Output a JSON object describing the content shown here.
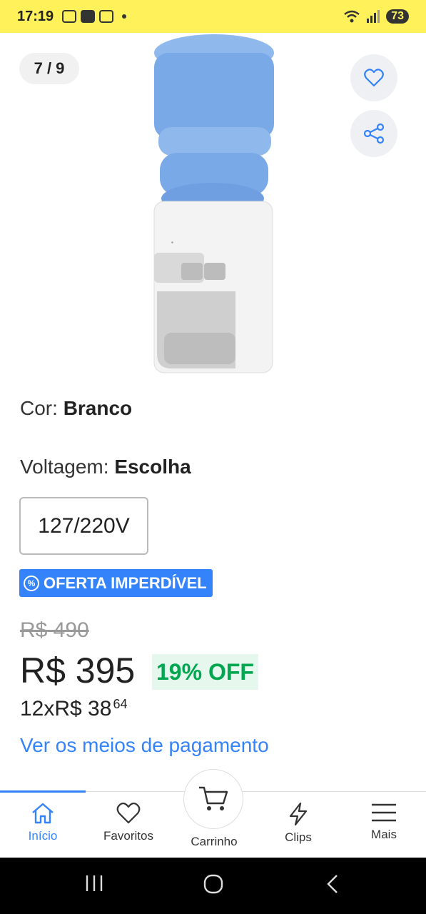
{
  "status_bar": {
    "time": "17:19",
    "battery": "73"
  },
  "gallery": {
    "counter": "7 / 9",
    "favorite_icon": "heart-outline-icon",
    "share_icon": "share-icon"
  },
  "options": {
    "color_label": "Cor: ",
    "color_value": "Branco",
    "voltage_label": "Voltagem: ",
    "voltage_value": "Escolha",
    "voltage_option": "127/220V"
  },
  "offer": {
    "badge": "OFERTA IMPERDÍVEL",
    "old_price": "R$ 490",
    "price": "R$ 395",
    "discount": "19% OFF",
    "installments_prefix": "12x ",
    "installments_value": "R$ 38",
    "installments_cents": "64",
    "payment_link": "Ver os meios de pagamento"
  },
  "bottom_nav": {
    "items": [
      {
        "label": "Início",
        "icon": "home-icon",
        "active": true
      },
      {
        "label": "Favoritos",
        "icon": "heart-icon"
      },
      {
        "label": "Carrinho",
        "icon": "cart-icon"
      },
      {
        "label": "Clips",
        "icon": "lightning-icon"
      },
      {
        "label": "Mais",
        "icon": "menu-icon"
      }
    ]
  },
  "colors": {
    "status_bar_bg": "#fff159",
    "accent_blue": "#3483fa",
    "discount_green": "#00a650"
  }
}
